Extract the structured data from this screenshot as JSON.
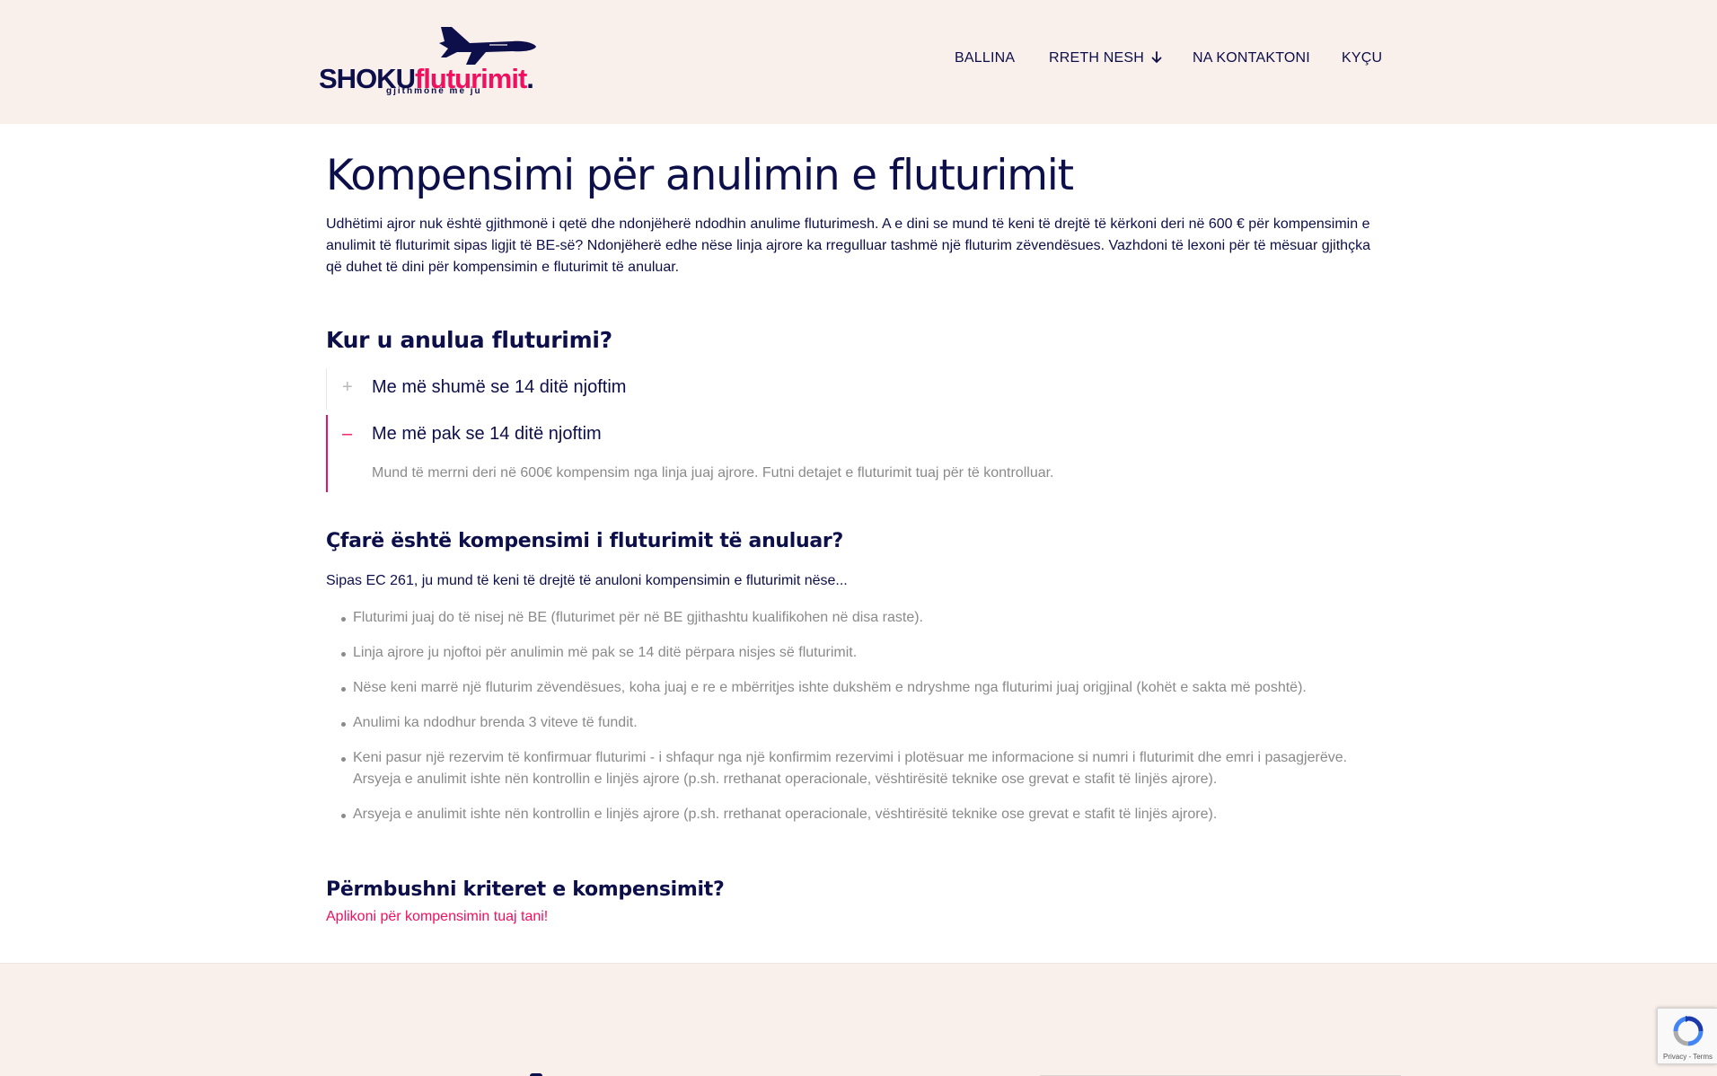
{
  "brand": {
    "name_part1": "SHOKU",
    "name_part2": "fluturimit",
    "name_dot": ".",
    "tagline": "gjithmonë me ju",
    "accent": "#f0105f",
    "navy": "#0d0f4a",
    "header_bg": "#f9efeb"
  },
  "nav": {
    "items": [
      {
        "label": "BALLINA"
      },
      {
        "label": "RRETH NESH",
        "icon": "arrow-down-icon"
      },
      {
        "label": "NA KONTAKTONI"
      },
      {
        "label": "KYÇU"
      }
    ]
  },
  "page": {
    "title": "Kompensimi për anulimin e fluturimit",
    "intro": "Udhëtimi ajror nuk është gjithmonë i qetë dhe ndonjëherë ndodhin anulime fluturimesh. A e dini se mund të keni të drejtë të kërkoni deri në 600 € për kompensimin e anulimit të fluturimit sipas ligjit të BE-së? Ndonjëherë edhe nëse linja ajrore ka rregulluar tashmë një fluturim zëvendësues. Vazhdoni të lexoni për të mësuar gjithçka që duhet të dini për kompensimin e fluturimit të anuluar."
  },
  "section1": {
    "heading": "Kur u anulua fluturimi?",
    "accordion": [
      {
        "sign": "+",
        "title": "Me më shumë se 14 ditë njoftim",
        "expanded": false
      },
      {
        "sign": "–",
        "title": "Me më pak se 14 ditë njoftim",
        "expanded": true,
        "body": "Mund të merrni deri në 600€ kompensim nga linja juaj ajrore. Futni detajet e fluturimit tuaj për të kontrolluar."
      }
    ]
  },
  "section2": {
    "heading": "Çfarë është kompensimi i fluturimit të anuluar?",
    "lead": "Sipas EC 261, ju mund të keni të drejtë të anuloni kompensimin e fluturimit nëse...",
    "bullets": [
      "Fluturimi juaj do të nisej në BE (fluturimet për në BE gjithashtu kualifikohen në disa raste).",
      "Linja ajrore ju njoftoi për anulimin më pak se 14 ditë përpara nisjes së fluturimit.",
      "Nëse keni marrë një fluturim zëvendësues, koha juaj e re e mbërritjes ishte dukshëm e ndryshme nga fluturimi juaj origjinal (kohët e sakta më poshtë).",
      "Anulimi ka ndodhur brenda 3 viteve të fundit.",
      "Keni pasur një rezervim të konfirmuar fluturimi - i shfaqur nga një konfirmim rezervimi i plotësuar me informacione si numri i fluturimit dhe emri i pasagjerëve. Arsyeja e anulimit ishte nën kontrollin e linjës ajrore (p.sh. rrethanat operacionale, vështirësitë teknike ose grevat e stafit të linjës ajrore).",
      "Arsyeja e anulimit ishte nën kontrollin e linjës ajrore (p.sh. rrethanat operacionale, vështirësitë teknike ose grevat e stafit të linjës ajrore)."
    ]
  },
  "section3": {
    "heading": "Përmbushni kriteret e kompensimit?",
    "cta": "Aplikoni për kompensimin tuaj tani!"
  },
  "recaptcha": {
    "privacy": "Privacy",
    "sep": " - ",
    "terms": "Terms"
  }
}
